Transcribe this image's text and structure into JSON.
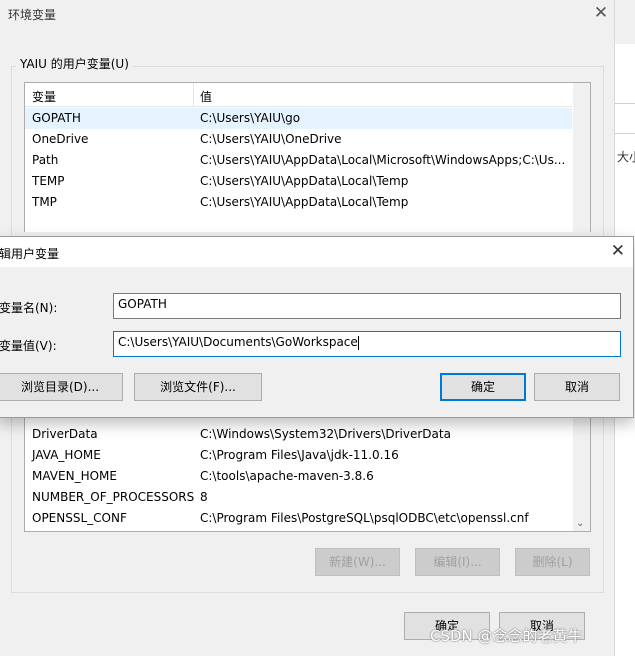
{
  "background_window": {
    "partial_text": "大小"
  },
  "env_dialog": {
    "title": "环境变量",
    "close_glyph": "✕",
    "user_group_label": "YAIU 的用户变量(U)",
    "columns": {
      "name": "变量",
      "value": "值"
    },
    "user_vars": [
      {
        "name": "GOPATH",
        "value": "C:\\Users\\YAIU\\go"
      },
      {
        "name": "OneDrive",
        "value": "C:\\Users\\YAIU\\OneDrive"
      },
      {
        "name": "Path",
        "value": "C:\\Users\\YAIU\\AppData\\Local\\Microsoft\\WindowsApps;C:\\Us..."
      },
      {
        "name": "TEMP",
        "value": "C:\\Users\\YAIU\\AppData\\Local\\Temp"
      },
      {
        "name": "TMP",
        "value": "C:\\Users\\YAIU\\AppData\\Local\\Temp"
      }
    ],
    "system_vars": [
      {
        "name": "DriverData",
        "value": "C:\\Windows\\System32\\Drivers\\DriverData"
      },
      {
        "name": "JAVA_HOME",
        "value": "C:\\Program Files\\Java\\jdk-11.0.16"
      },
      {
        "name": "MAVEN_HOME",
        "value": "C:\\tools\\apache-maven-3.8.6"
      },
      {
        "name": "NUMBER_OF_PROCESSORS",
        "value": "8"
      },
      {
        "name": "OPENSSL_CONF",
        "value": "C:\\Program Files\\PostgreSQL\\psqlODBC\\etc\\openssl.cnf"
      }
    ],
    "system_buttons": {
      "new": "新建(W)...",
      "edit": "编辑(I)...",
      "delete": "删除(L)"
    },
    "ok": "确定",
    "cancel": "取消"
  },
  "edit_dialog": {
    "title": "辑用户变量",
    "close_glyph": "✕",
    "name_label": "变量名(N):",
    "name_value": "GOPATH",
    "value_label": "变量值(V):",
    "value_value": "C:\\Users\\YAIU\\Documents\\GoWorkspace",
    "browse_dir": "浏览目录(D)...",
    "browse_file": "浏览文件(F)...",
    "ok": "确定",
    "cancel": "取消"
  },
  "watermark": "CSDN @念念的老黄牛",
  "colors": {
    "selection": "#e5f3ff",
    "focus_border": "#0078d7",
    "dialog_bg": "#f0f0f0"
  }
}
